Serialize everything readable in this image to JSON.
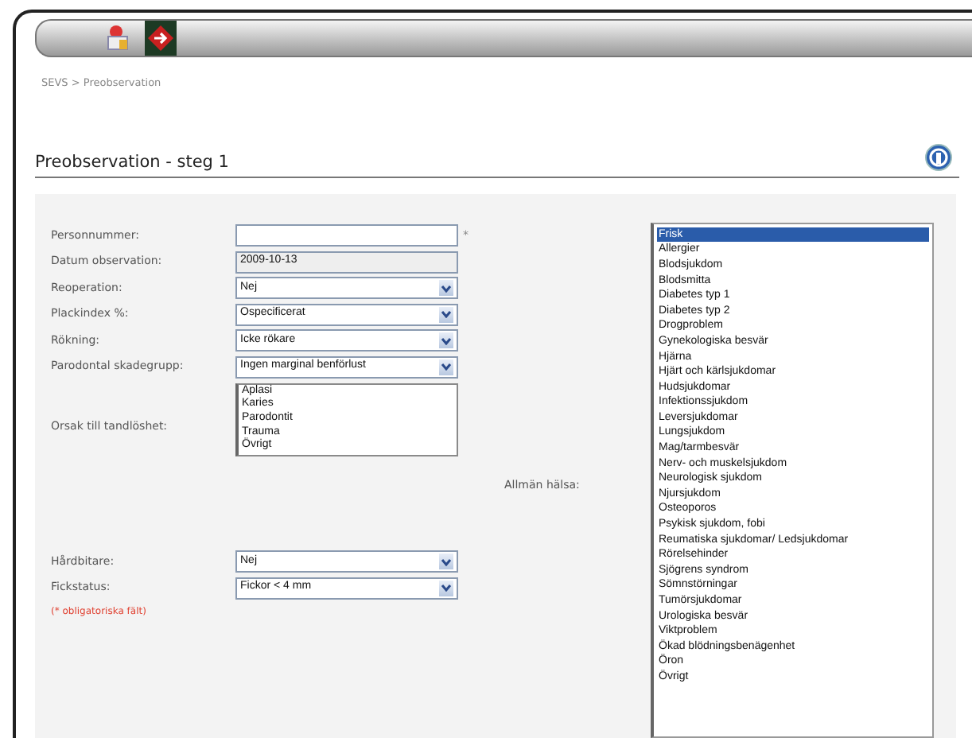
{
  "breadcrumb": "SEVS > Preobservation",
  "title": "Preobservation - steg 1",
  "fields": [
    {
      "kind": "text",
      "label": "Personnummer:",
      "required_mark": "*"
    },
    {
      "kind": "readonly",
      "label": "Datum observation:",
      "value": "2009-10-13"
    },
    {
      "kind": "select",
      "label": "Reoperation:",
      "value": "Nej"
    },
    {
      "kind": "select",
      "label": "Plackindex %:",
      "value": "Ospecificerat"
    },
    {
      "kind": "select",
      "label": "Rökning:",
      "value": "Icke rökare"
    },
    {
      "kind": "select",
      "label": "Parodontal skadegrupp:",
      "value": "Ingen marginal benförlust"
    },
    {
      "kind": "listbox",
      "label": "Orsak till tandlöshet:",
      "options": [
        "Aplasi",
        "Karies",
        "Parodontit",
        "Trauma",
        "Övrigt"
      ]
    },
    {
      "kind": "select",
      "label": "Hårdbitare:",
      "value": "Nej"
    },
    {
      "kind": "select",
      "label": "Fickstatus:",
      "value": "Fickor < 4 mm"
    }
  ],
  "required_note": "(* obligatoriska fält)",
  "health": {
    "label": "Allmän hälsa:",
    "options": [
      {
        "text": "Frisk",
        "selected": true
      },
      {
        "text": "Allergier",
        "selected": false
      },
      {
        "text": "Blodsjukdom",
        "selected": false
      },
      {
        "text": "Blodsmitta",
        "selected": false
      },
      {
        "text": "Diabetes typ 1",
        "selected": false
      },
      {
        "text": "Diabetes typ 2",
        "selected": false
      },
      {
        "text": "Drogproblem",
        "selected": false
      },
      {
        "text": "Gynekologiska besvär",
        "selected": false
      },
      {
        "text": "Hjärna",
        "selected": false
      },
      {
        "text": "Hjärt och kärlsjukdomar",
        "selected": false
      },
      {
        "text": "Hudsjukdomar",
        "selected": false
      },
      {
        "text": "Infektionssjukdom",
        "selected": false
      },
      {
        "text": "Leversjukdomar",
        "selected": false
      },
      {
        "text": "Lungsjukdom",
        "selected": false
      },
      {
        "text": "Mag/tarmbesvär",
        "selected": false
      },
      {
        "text": "Nerv- och muskelsjukdom",
        "selected": false
      },
      {
        "text": "Neurologisk sjukdom",
        "selected": false
      },
      {
        "text": "Njursjukdom",
        "selected": false
      },
      {
        "text": "Osteoporos",
        "selected": false
      },
      {
        "text": "Psykisk sjukdom, fobi",
        "selected": false
      },
      {
        "text": "Reumatiska sjukdomar/ Ledsjukdomar",
        "selected": false
      },
      {
        "text": "Rörelsehinder",
        "selected": false
      },
      {
        "text": "Sjögrens syndrom",
        "selected": false
      },
      {
        "text": "Sömnstörningar",
        "selected": false
      },
      {
        "text": "Tumörsjukdomar",
        "selected": false
      },
      {
        "text": "Urologiska besvär",
        "selected": false
      },
      {
        "text": "Viktproblem",
        "selected": false
      },
      {
        "text": "Ökad blödningsbenägenhet",
        "selected": false
      },
      {
        "text": "Öron",
        "selected": false
      },
      {
        "text": "Övrigt",
        "selected": false
      }
    ]
  }
}
